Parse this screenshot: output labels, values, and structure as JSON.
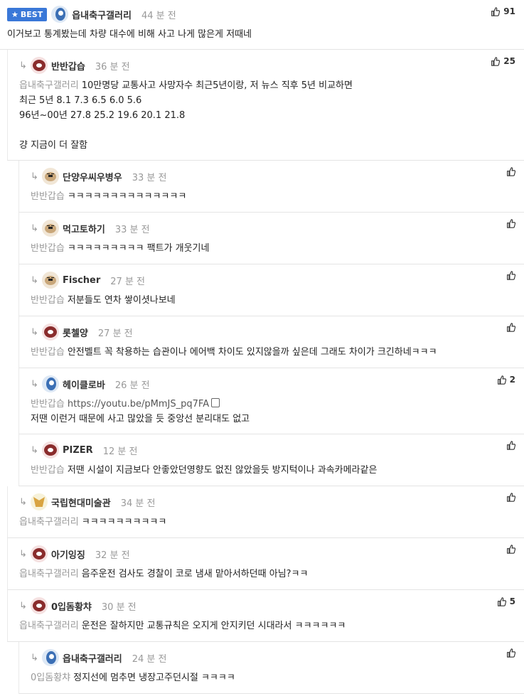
{
  "best_badge": "BEST",
  "comments": [
    {
      "nick": "읍내축구갤러리",
      "time": "44 분 전",
      "likes": "91",
      "mention": "",
      "lines": [
        "이거보고 통계봤는데 차량 대수에 비해 사고 나게 많은게 저때네"
      ]
    },
    {
      "nick": "반반갑습",
      "time": "36 분 전",
      "likes": "25",
      "mention": "읍내축구갤러리",
      "lines": [
        "10만명당 교통사고 사망자수 최근5년이랑, 저 뉴스 직후 5년 비교하면",
        "최근 5년 8.1 7.3 6.5 6.0 5.6",
        "96년~00년 27.8 25.2 19.6 20.1 21.8",
        "",
        "걍 지금이 더 잘함"
      ]
    },
    {
      "nick": "단양우씨우병우",
      "time": "33 분 전",
      "likes": "",
      "mention": "반반갑습",
      "lines": [
        "ㅋㅋㅋㅋㅋㅋㅋㅋㅋㅋㅋㅋㅋㅋ"
      ]
    },
    {
      "nick": "먹고토하기",
      "time": "33 분 전",
      "likes": "",
      "mention": "반반갑습",
      "lines": [
        "ㅋㅋㅋㅋㅋㅋㅋㅋㅋ 팩트가 개웃기네"
      ]
    },
    {
      "nick": "Fischer",
      "time": "27 분 전",
      "likes": "",
      "mention": "반반갑습",
      "lines": [
        "저분들도 연차 쌓이셧나보네"
      ]
    },
    {
      "nick": "롯첼양",
      "time": "27 분 전",
      "likes": "",
      "mention": "반반갑습",
      "lines": [
        "안전벨트 꼭 착용하는 습관이나 에어백 차이도 있지않을까 싶은데 그래도 차이가 크긴하네ㅋㅋㅋ"
      ]
    },
    {
      "nick": "헤이클로바",
      "time": "26 분 전",
      "likes": "2",
      "mention": "반반갑습",
      "link": "https://youtu.be/pMmJS_pq7FA",
      "lines": [
        "저땐 이런거 때문에 사고 많았을 듯 중앙선 분리대도 없고"
      ]
    },
    {
      "nick": "PIZER",
      "time": "12 분 전",
      "likes": "",
      "mention": "반반갑습",
      "lines": [
        "저땐 시설이 지금보다 안좋았던영향도 없진 않았을듯 방지턱이나 과속카메라같은"
      ]
    },
    {
      "nick": "국립현대미술관",
      "time": "34 분 전",
      "likes": "",
      "mention": "읍내축구갤러리",
      "lines": [
        "ㅋㅋㅋㅋㅋㅋㅋㅋㅋㅋ"
      ]
    },
    {
      "nick": "아기잉징",
      "time": "32 분 전",
      "likes": "",
      "mention": "읍내축구갤러리",
      "lines": [
        "음주운전 검사도 경찰이 코로 냄새 맡아서하던때 아님?ㅋㅋ"
      ]
    },
    {
      "nick": "0입돔황챠",
      "time": "30 분 전",
      "likes": "5",
      "mention": "읍내축구갤러리",
      "lines": [
        "운전은 잘하지만 교통규칙은 오지게 안지키던 시대라서 ㅋㅋㅋㅋㅋㅋ"
      ]
    },
    {
      "nick": "읍내축구갤러리",
      "time": "24 분 전",
      "likes": "",
      "mention": "0입돔황챠",
      "lines": [
        "정지선에 멈추면 냉장고주던시절 ㅋㅋㅋㅋ"
      ]
    }
  ]
}
